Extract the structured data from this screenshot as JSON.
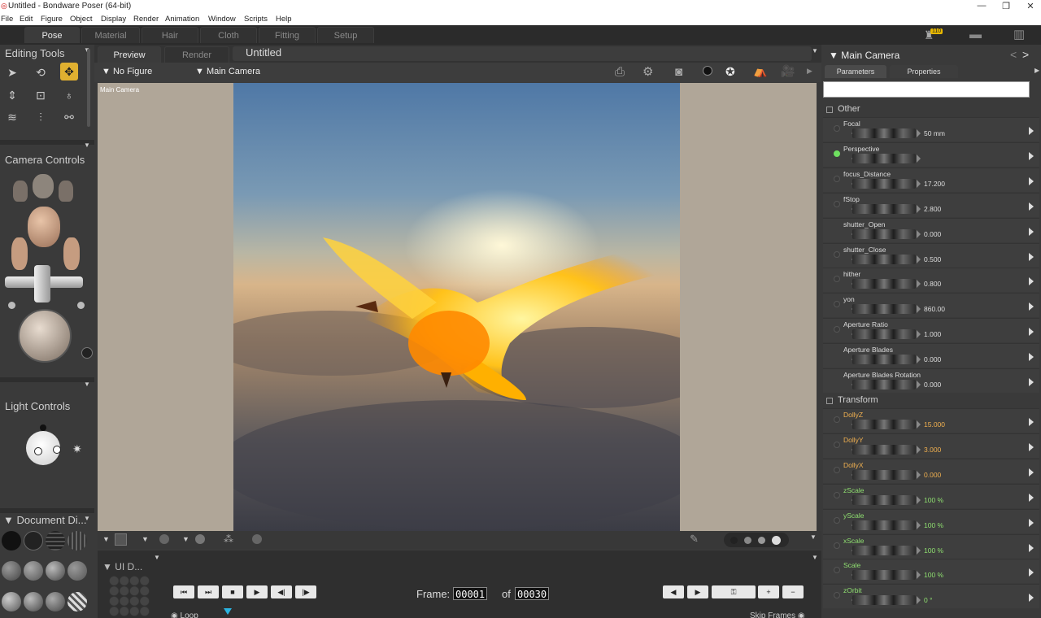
{
  "window": {
    "title": "Untitled - Bondware Poser (64-bit)",
    "minimize": "—",
    "restore": "❐",
    "close": "✕"
  },
  "menu": [
    "File",
    "Edit",
    "Figure",
    "Object",
    "Display",
    "Render",
    "Animation",
    "Window",
    "Scripts",
    "Help"
  ],
  "rooms": [
    "Pose",
    "Material",
    "Hair",
    "Cloth",
    "Fitting",
    "Setup"
  ],
  "badge": "110",
  "left": {
    "editing_tools": "Editing Tools",
    "camera_controls": "Camera Controls",
    "light_controls": "Light Controls",
    "document_display": "Document Di..."
  },
  "viewport": {
    "tabs": [
      "Preview",
      "Render"
    ],
    "doc_title": "Untitled",
    "figure_select": "No Figure",
    "camera_select": "Main Camera",
    "camera_label": "Main Camera"
  },
  "timeline": {
    "ui_dots": "UI D...",
    "frame_label": "Frame:",
    "frame_current": "00001",
    "of_label": "of",
    "frame_total": "00030",
    "loop": "Loop",
    "skip_frames": "Skip Frames"
  },
  "panel": {
    "title": "Main Camera",
    "tab_parameters": "Parameters",
    "tab_properties": "Properties",
    "groups": {
      "other": "Other",
      "transform": "Transform"
    },
    "params": [
      {
        "label": "Focal",
        "value": "50 mm",
        "color": "normal",
        "radio": "off"
      },
      {
        "label": "Perspective",
        "value": "",
        "color": "normal",
        "radio": "on"
      },
      {
        "label": "focus_Distance",
        "value": "17.200",
        "color": "normal",
        "radio": "off"
      },
      {
        "label": "fStop",
        "value": "2.800",
        "color": "normal",
        "radio": "off"
      },
      {
        "label": "shutter_Open",
        "value": "0.000",
        "color": "normal",
        "radio": "none"
      },
      {
        "label": "shutter_Close",
        "value": "0.500",
        "color": "normal",
        "radio": "off"
      },
      {
        "label": "hither",
        "value": "0.800",
        "color": "normal",
        "radio": "off"
      },
      {
        "label": "yon",
        "value": "860.00",
        "color": "normal",
        "radio": "off"
      },
      {
        "label": "Aperture Ratio",
        "value": "1.000",
        "color": "normal",
        "radio": "off"
      },
      {
        "label": "Aperture Blades",
        "value": "0.000",
        "color": "normal",
        "radio": "none"
      },
      {
        "label": "Aperture Blades Rotation",
        "value": "0.000",
        "color": "normal",
        "radio": "none"
      }
    ],
    "transform": [
      {
        "label": "DollyZ",
        "value": "15.000",
        "color": "orange"
      },
      {
        "label": "DollyY",
        "value": "3.000",
        "color": "orange"
      },
      {
        "label": "DollyX",
        "value": "0.000",
        "color": "orange"
      },
      {
        "label": "zScale",
        "value": "100 %",
        "color": "green"
      },
      {
        "label": "yScale",
        "value": "100 %",
        "color": "green"
      },
      {
        "label": "xScale",
        "value": "100 %",
        "color": "green"
      },
      {
        "label": "Scale",
        "value": "100 %",
        "color": "green"
      },
      {
        "label": "zOrbit",
        "value": "0 °",
        "color": "green"
      }
    ]
  }
}
